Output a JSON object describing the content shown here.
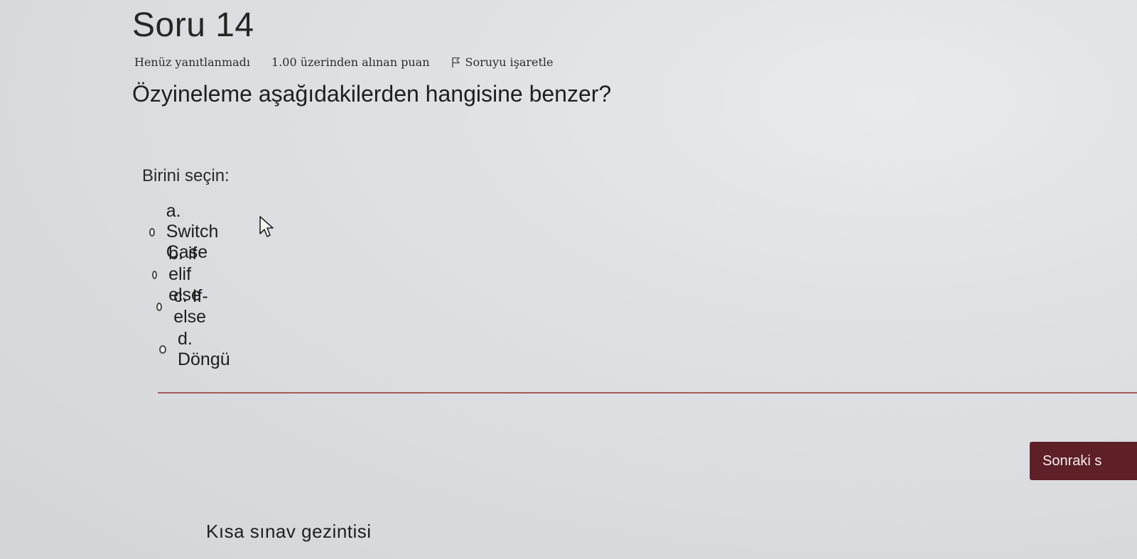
{
  "question": {
    "number_label": "Soru 14",
    "state": "Henüz yanıtlanmadı",
    "grade": "1.00 üzerinden alınan puan",
    "flag_label": "Soruyu işaretle",
    "text": "Özyineleme aşağıdakilerden hangisine benzer?",
    "prompt": "Birini seçin:",
    "answers": [
      {
        "label": "a. Switch Case"
      },
      {
        "label": "b. if elif else"
      },
      {
        "label": "c. If-else"
      },
      {
        "label": "d. Döngü"
      }
    ]
  },
  "navigation": {
    "next_label": "Sonraki s",
    "quiz_nav_title": "Kısa sınav gezintisi"
  },
  "icons": {
    "flag": "flag-icon",
    "cursor": "mouse-pointer-icon"
  },
  "colors": {
    "accent": "#5e1f27",
    "divider": "#a65a5a"
  }
}
